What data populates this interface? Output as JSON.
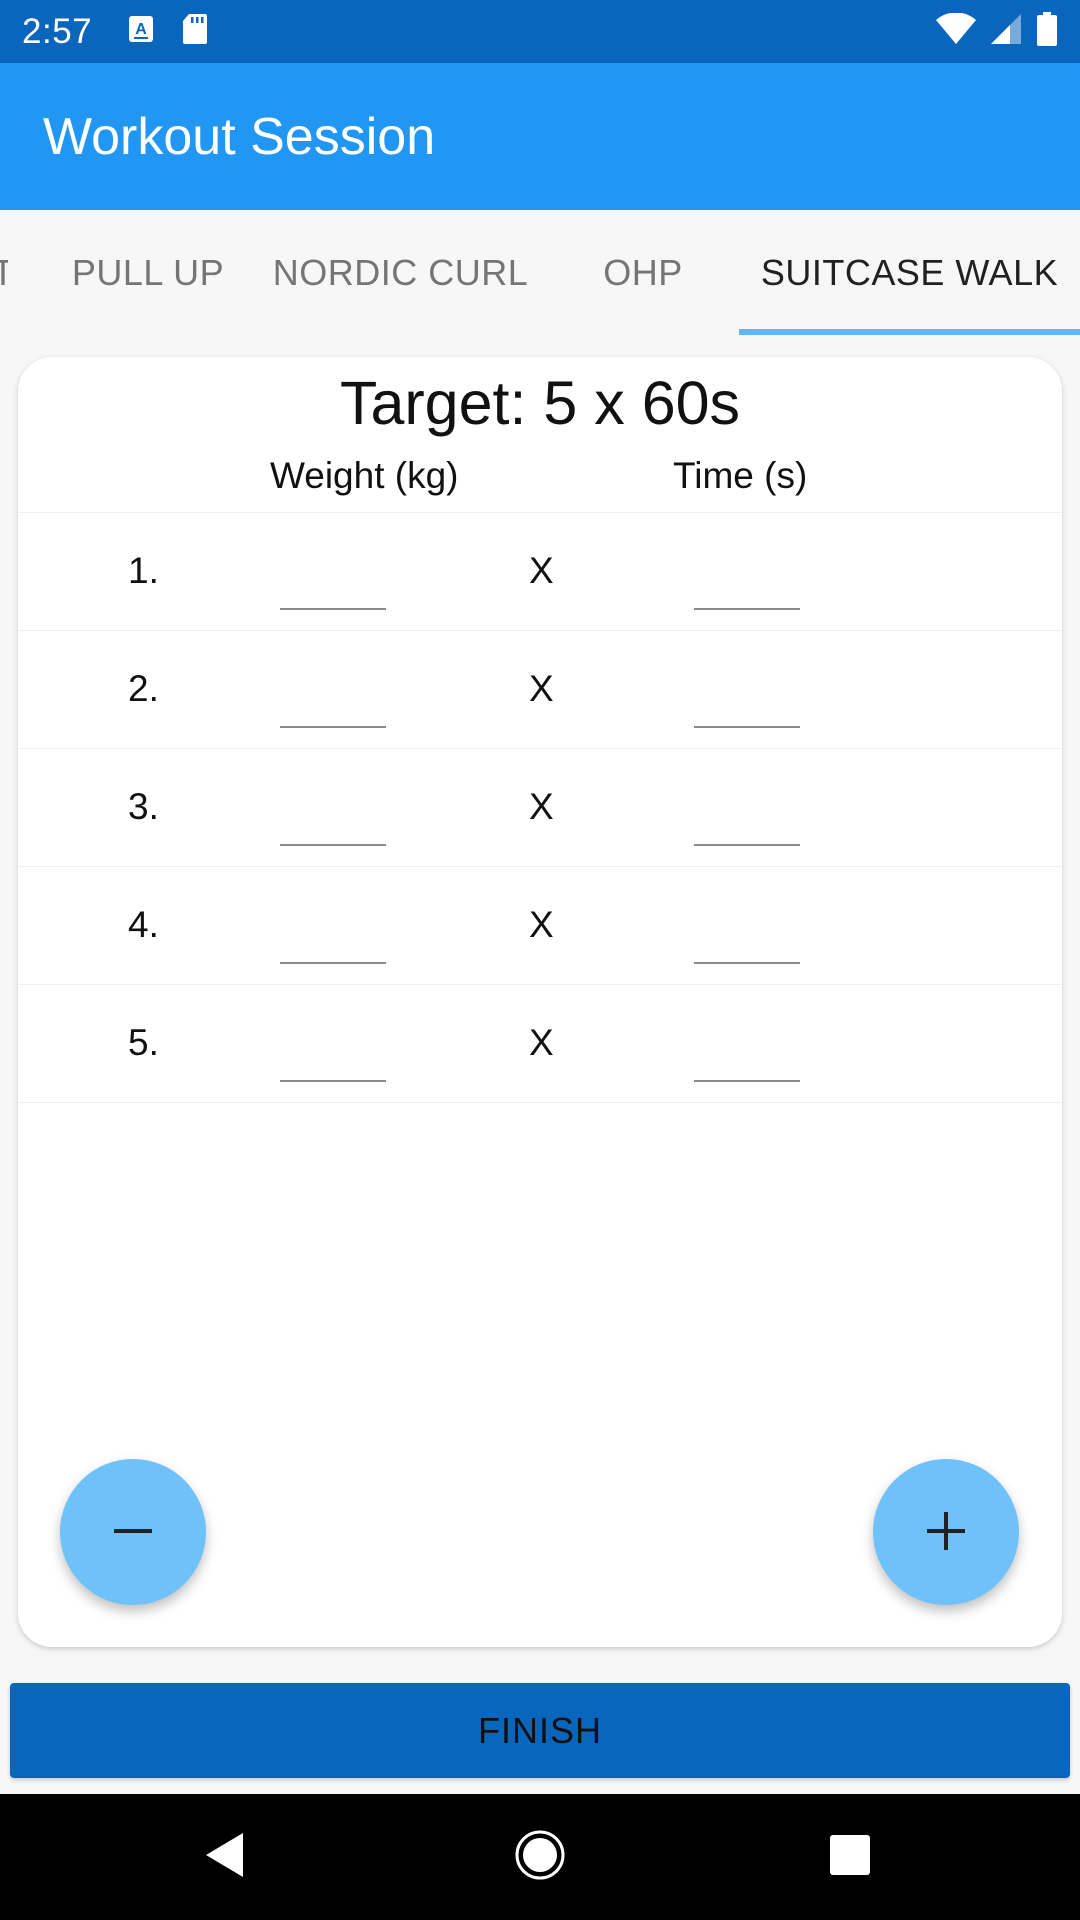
{
  "status_bar": {
    "time": "2:57",
    "icons": [
      "a-notification-icon",
      "sd-card-icon",
      "wifi-icon",
      "cell-signal-icon",
      "battery-icon"
    ]
  },
  "app_bar": {
    "title": "Workout Session"
  },
  "tabs": [
    {
      "label": "T"
    },
    {
      "label": "PULL UP"
    },
    {
      "label": "NORDIC CURL"
    },
    {
      "label": "OHP"
    },
    {
      "label": "SUITCASE WALK",
      "active": true
    }
  ],
  "exercise": {
    "target": "Target: 5 x 60s",
    "weight_header": "Weight (kg)",
    "time_header": "Time (s)",
    "separator": "X",
    "sets": [
      {
        "number": "1.",
        "weight": "",
        "time": ""
      },
      {
        "number": "2.",
        "weight": "",
        "time": ""
      },
      {
        "number": "3.",
        "weight": "",
        "time": ""
      },
      {
        "number": "4.",
        "weight": "",
        "time": ""
      },
      {
        "number": "5.",
        "weight": "",
        "time": ""
      }
    ]
  },
  "fabs": {
    "minus_icon": "minus-icon",
    "plus_icon": "plus-icon"
  },
  "finish_label": "FINISH",
  "colors": {
    "status_bar": "#0A66BD",
    "app_bar": "#2196F3",
    "tab_indicator": "#64B5F6",
    "fab": "#6EC1F9",
    "finish_button": "#0A66BD"
  }
}
